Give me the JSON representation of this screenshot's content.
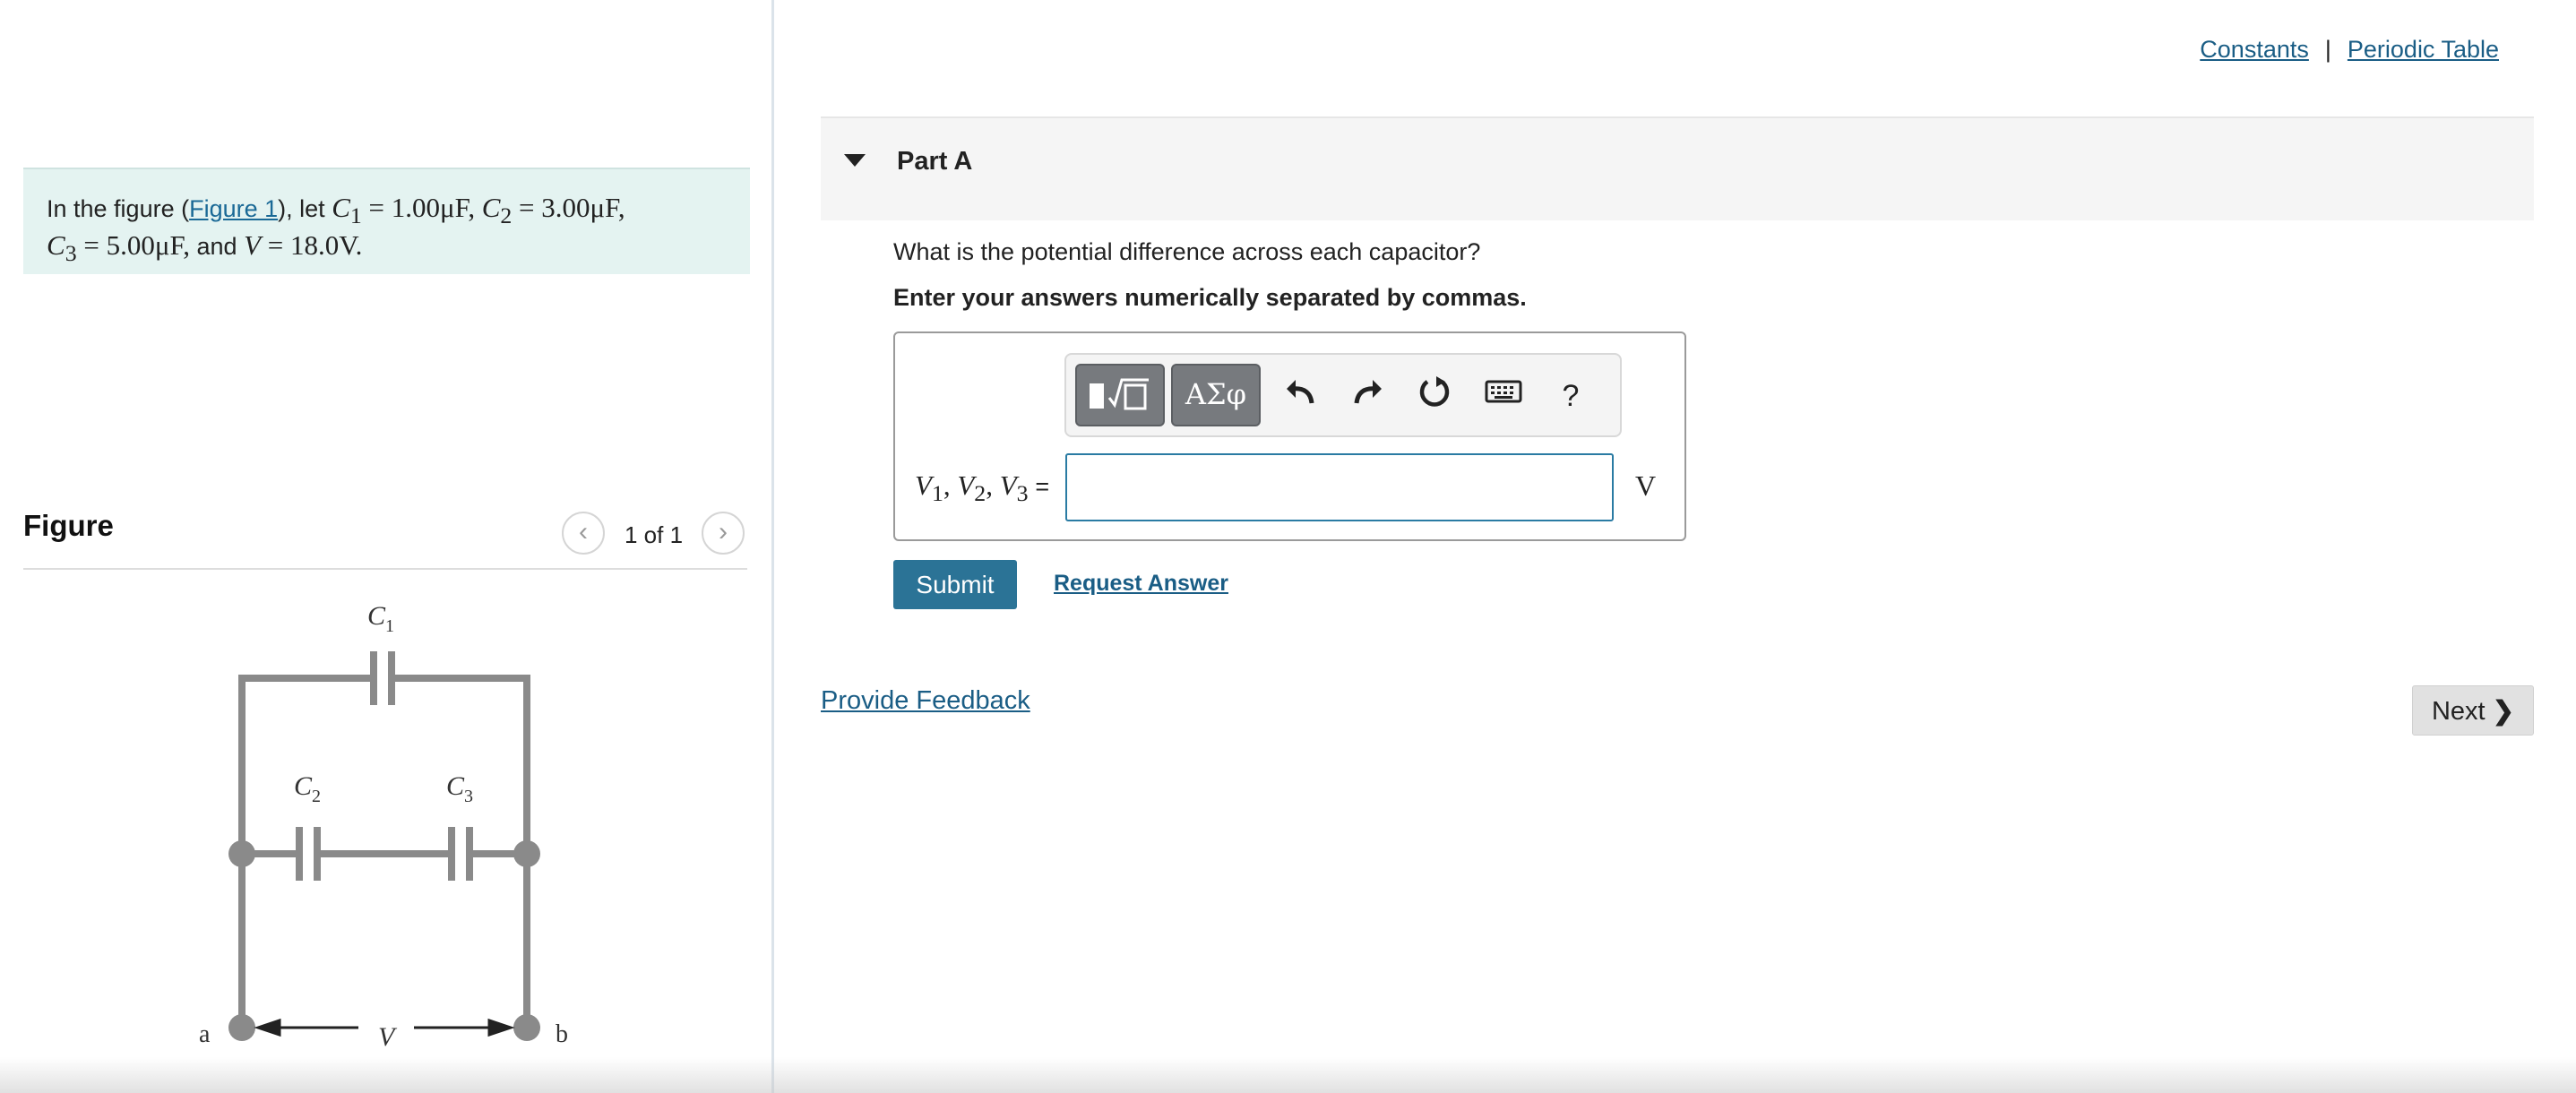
{
  "problem": {
    "prefix": "In the figure (",
    "figure_link": "Figure 1",
    "suffix": "), let",
    "c1_sym": "C",
    "c1_sub": "1",
    "c1_val": "= 1.00μF,",
    "c2_sym": "C",
    "c2_sub": "2",
    "c2_val": "= 3.00μF,",
    "c3_sym": "C",
    "c3_sub": "3",
    "c3_val": "= 5.00μF,",
    "and_text": "and",
    "v_sym": "V",
    "v_val": "= 18.0V."
  },
  "figure": {
    "title": "Figure",
    "counter": "1 of 1",
    "prev_glyph": "‹",
    "next_glyph": "›",
    "labels": {
      "c1": "C",
      "c1_sub": "1",
      "c2": "C",
      "c2_sub": "2",
      "c3": "C",
      "c3_sub": "3",
      "a": "a",
      "b": "b",
      "v": "V"
    }
  },
  "links": {
    "constants": "Constants",
    "separator": "|",
    "periodic_table": "Periodic Table"
  },
  "part": {
    "title": "Part A",
    "question": "What is the potential difference across each capacitor?",
    "instruction": "Enter your answers numerically separated by commas."
  },
  "toolbar": {
    "symbols_label": "ΑΣφ",
    "undo_icon": "undo-icon",
    "redo_icon": "redo-icon",
    "reset_icon": "reset-icon",
    "keyboard_icon": "keyboard-icon",
    "help_label": "?"
  },
  "answer": {
    "var_v": "V",
    "sub1": "1",
    "sub2": "2",
    "sub3": "3",
    "equals": "=",
    "value": "",
    "unit": "V"
  },
  "actions": {
    "submit": "Submit",
    "request_answer": "Request Answer",
    "provide_feedback": "Provide Feedback",
    "next": "Next"
  },
  "colors": {
    "problem_bg": "#e4f3f1",
    "link": "#1a5d85",
    "submit_bg": "#2b7396",
    "toolbar_btn": "#777a7e",
    "circuit_wire": "#8a8a8a"
  }
}
